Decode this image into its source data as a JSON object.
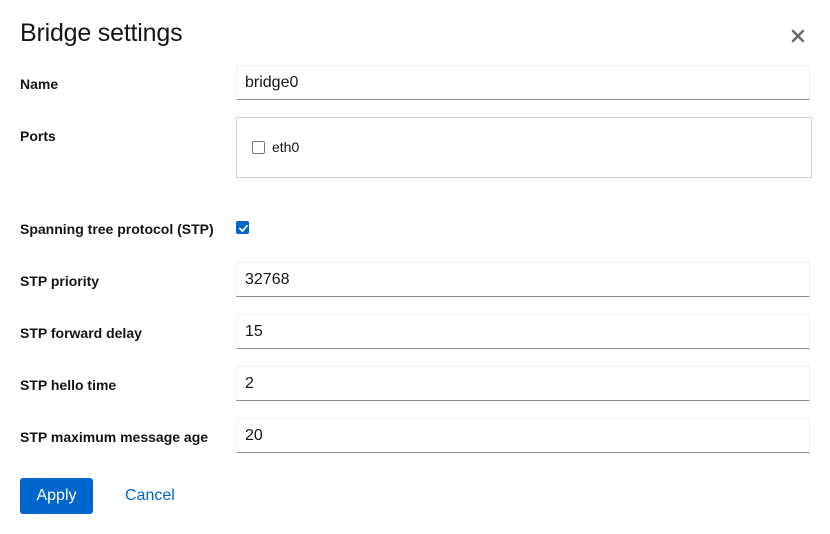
{
  "dialog": {
    "title": "Bridge settings",
    "close_icon": "close-icon"
  },
  "fields": {
    "name": {
      "label": "Name",
      "value": "bridge0"
    },
    "ports": {
      "label": "Ports",
      "items": [
        {
          "label": "eth0",
          "checked": false
        }
      ]
    },
    "stp": {
      "label": "Spanning tree protocol (STP)",
      "checked": true
    },
    "stp_priority": {
      "label": "STP priority",
      "value": "32768"
    },
    "stp_forward_delay": {
      "label": "STP forward delay",
      "value": "15"
    },
    "stp_hello_time": {
      "label": "STP hello time",
      "value": "2"
    },
    "stp_max_age": {
      "label": "STP maximum message age",
      "value": "20"
    }
  },
  "footer": {
    "apply_label": "Apply",
    "cancel_label": "Cancel"
  },
  "colors": {
    "primary": "#0066cc",
    "text": "#151515",
    "border": "#d2d2d2"
  }
}
